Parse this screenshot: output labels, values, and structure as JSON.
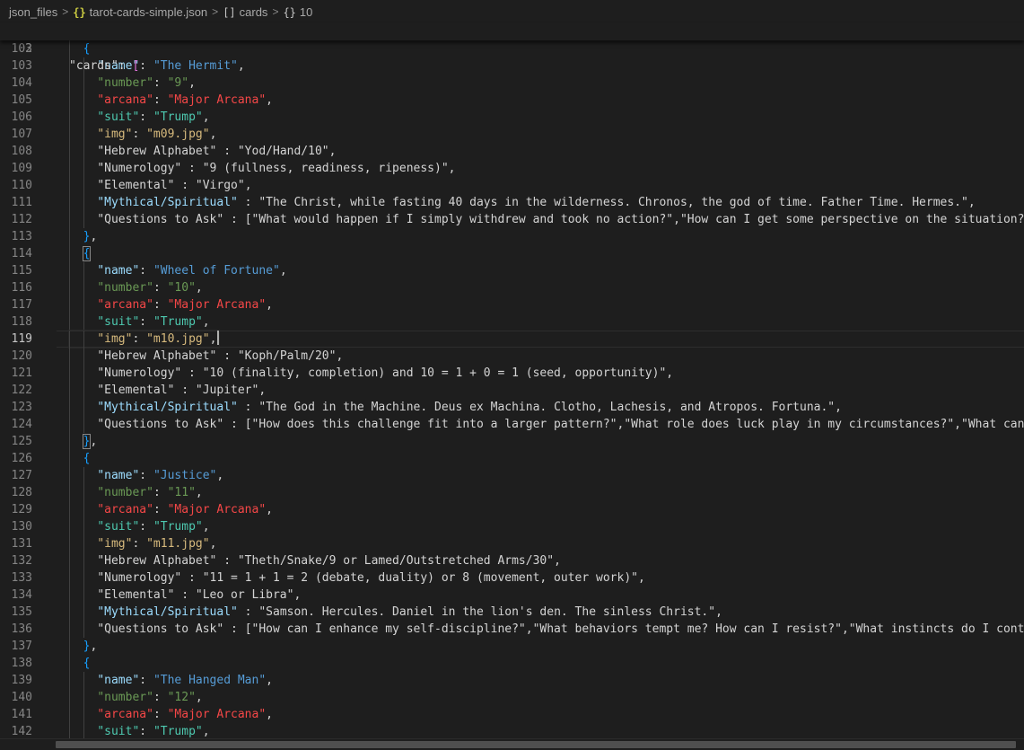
{
  "breadcrumb": {
    "folder": "json_files",
    "file": "tarot-cards-simple.json",
    "array_node": "cards",
    "object_node": "10",
    "file_icon_glyph": "{}",
    "array_icon_glyph": "[]",
    "object_icon_glyph": "{}"
  },
  "sticky_line": {
    "number": "3",
    "key": "\"cards\"",
    "sep": ": ",
    "bracket": "["
  },
  "current_line": "119",
  "lines": [
    {
      "n": "102",
      "indent": "      ",
      "tokens": [
        {
          "t": "{",
          "c": "b-brace"
        }
      ]
    },
    {
      "n": "103",
      "indent": "        ",
      "tokens": [
        {
          "t": "\"name\"",
          "c": "kn"
        },
        {
          "t": ": ",
          "c": "punc"
        },
        {
          "t": "\"The Hermit\"",
          "c": "sn"
        },
        {
          "t": ",",
          "c": "punc"
        }
      ]
    },
    {
      "n": "104",
      "indent": "        ",
      "tokens": [
        {
          "t": "\"number\"",
          "c": "kb"
        },
        {
          "t": ": ",
          "c": "punc"
        },
        {
          "t": "\"9\"",
          "c": "sb"
        },
        {
          "t": ",",
          "c": "punc"
        }
      ]
    },
    {
      "n": "105",
      "indent": "        ",
      "tokens": [
        {
          "t": "\"arcana\"",
          "c": "kr"
        },
        {
          "t": ": ",
          "c": "punc"
        },
        {
          "t": "\"Major Arcana\"",
          "c": "sr"
        },
        {
          "t": ",",
          "c": "punc"
        }
      ]
    },
    {
      "n": "106",
      "indent": "        ",
      "tokens": [
        {
          "t": "\"suit\"",
          "c": "kg"
        },
        {
          "t": ": ",
          "c": "punc"
        },
        {
          "t": "\"Trump\"",
          "c": "sg"
        },
        {
          "t": ",",
          "c": "punc"
        }
      ]
    },
    {
      "n": "107",
      "indent": "        ",
      "tokens": [
        {
          "t": "\"img\"",
          "c": "ko"
        },
        {
          "t": ": ",
          "c": "punc"
        },
        {
          "t": "\"m09.jpg\"",
          "c": "so"
        },
        {
          "t": ",",
          "c": "punc"
        }
      ]
    },
    {
      "n": "108",
      "indent": "        ",
      "tokens": [
        {
          "t": "\"Hebrew Alphabet\"",
          "c": "kw"
        },
        {
          "t": " : ",
          "c": "punc"
        },
        {
          "t": "\"Yod/Hand/10\"",
          "c": "sw"
        },
        {
          "t": ",",
          "c": "punc"
        }
      ]
    },
    {
      "n": "109",
      "indent": "        ",
      "tokens": [
        {
          "t": "\"Numerology\"",
          "c": "kw"
        },
        {
          "t": " : ",
          "c": "punc"
        },
        {
          "t": "\"9 (fullness, readiness, ripeness)\"",
          "c": "sw"
        },
        {
          "t": ",",
          "c": "punc"
        }
      ]
    },
    {
      "n": "110",
      "indent": "        ",
      "tokens": [
        {
          "t": "\"Elemental\"",
          "c": "kw"
        },
        {
          "t": " : ",
          "c": "punc"
        },
        {
          "t": "\"Virgo\"",
          "c": "sw"
        },
        {
          "t": ",",
          "c": "punc"
        }
      ]
    },
    {
      "n": "111",
      "indent": "        ",
      "tokens": [
        {
          "t": "\"Mythical/Spiritual\"",
          "c": "km"
        },
        {
          "t": " : ",
          "c": "punc"
        },
        {
          "t": "\"The Christ, while fasting 40 days in the wilderness. Chronos, the god of time. Father Time. Hermes.\"",
          "c": "sm"
        },
        {
          "t": ",",
          "c": "punc"
        }
      ]
    },
    {
      "n": "112",
      "indent": "        ",
      "tokens": [
        {
          "t": "\"Questions to Ask\"",
          "c": "kw"
        },
        {
          "t": " : ",
          "c": "punc"
        },
        {
          "t": "[",
          "c": "sw"
        },
        {
          "t": "\"What would happen if I simply withdrew and took no action?\",\"How can I get some perspective on the situation?\",",
          "c": "sw"
        }
      ]
    },
    {
      "n": "113",
      "indent": "      ",
      "tokens": [
        {
          "t": "}",
          "c": "b-brace"
        },
        {
          "t": ",",
          "c": "punc"
        }
      ]
    },
    {
      "n": "114",
      "indent": "      ",
      "tokens": [
        {
          "t": "{",
          "c": "b-brace match"
        }
      ]
    },
    {
      "n": "115",
      "indent": "        ",
      "tokens": [
        {
          "t": "\"name\"",
          "c": "kn"
        },
        {
          "t": ": ",
          "c": "punc"
        },
        {
          "t": "\"Wheel of Fortune\"",
          "c": "sn"
        },
        {
          "t": ",",
          "c": "punc"
        }
      ]
    },
    {
      "n": "116",
      "indent": "        ",
      "tokens": [
        {
          "t": "\"number\"",
          "c": "kb"
        },
        {
          "t": ": ",
          "c": "punc"
        },
        {
          "t": "\"10\"",
          "c": "sb"
        },
        {
          "t": ",",
          "c": "punc"
        }
      ]
    },
    {
      "n": "117",
      "indent": "        ",
      "tokens": [
        {
          "t": "\"arcana\"",
          "c": "kr"
        },
        {
          "t": ": ",
          "c": "punc"
        },
        {
          "t": "\"Major Arcana\"",
          "c": "sr"
        },
        {
          "t": ",",
          "c": "punc"
        }
      ]
    },
    {
      "n": "118",
      "indent": "        ",
      "tokens": [
        {
          "t": "\"suit\"",
          "c": "kg"
        },
        {
          "t": ": ",
          "c": "punc"
        },
        {
          "t": "\"Trump\"",
          "c": "sg"
        },
        {
          "t": ",",
          "c": "punc"
        }
      ]
    },
    {
      "n": "119",
      "indent": "        ",
      "tokens": [
        {
          "t": "\"img\"",
          "c": "ko"
        },
        {
          "t": ": ",
          "c": "punc"
        },
        {
          "t": "\"m10.jpg\"",
          "c": "so"
        },
        {
          "t": ",",
          "c": "punc"
        }
      ],
      "caret": true
    },
    {
      "n": "120",
      "indent": "        ",
      "tokens": [
        {
          "t": "\"Hebrew Alphabet\"",
          "c": "kw"
        },
        {
          "t": " : ",
          "c": "punc"
        },
        {
          "t": "\"Koph/Palm/20\"",
          "c": "sw"
        },
        {
          "t": ",",
          "c": "punc"
        }
      ]
    },
    {
      "n": "121",
      "indent": "        ",
      "tokens": [
        {
          "t": "\"Numerology\"",
          "c": "kw"
        },
        {
          "t": " : ",
          "c": "punc"
        },
        {
          "t": "\"10 (finality, completion) and 10 = 1 + 0 = 1 (seed, opportunity)\"",
          "c": "sw"
        },
        {
          "t": ",",
          "c": "punc"
        }
      ]
    },
    {
      "n": "122",
      "indent": "        ",
      "tokens": [
        {
          "t": "\"Elemental\"",
          "c": "kw"
        },
        {
          "t": " : ",
          "c": "punc"
        },
        {
          "t": "\"Jupiter\"",
          "c": "sw"
        },
        {
          "t": ",",
          "c": "punc"
        }
      ]
    },
    {
      "n": "123",
      "indent": "        ",
      "tokens": [
        {
          "t": "\"Mythical/Spiritual\"",
          "c": "km"
        },
        {
          "t": " : ",
          "c": "punc"
        },
        {
          "t": "\"The God in the Machine. Deus ex Machina. Clotho, Lachesis, and Atropos. Fortuna.\"",
          "c": "sm"
        },
        {
          "t": ",",
          "c": "punc"
        }
      ]
    },
    {
      "n": "124",
      "indent": "        ",
      "tokens": [
        {
          "t": "\"Questions to Ask\"",
          "c": "kw"
        },
        {
          "t": " : ",
          "c": "punc"
        },
        {
          "t": "[",
          "c": "sw"
        },
        {
          "t": "\"How does this challenge fit into a larger pattern?\",\"What role does luck play in my circumstances?\",\"What can I",
          "c": "sw"
        }
      ]
    },
    {
      "n": "125",
      "indent": "      ",
      "tokens": [
        {
          "t": "}",
          "c": "b-brace match"
        },
        {
          "t": ",",
          "c": "punc"
        }
      ]
    },
    {
      "n": "126",
      "indent": "      ",
      "tokens": [
        {
          "t": "{",
          "c": "b-brace"
        }
      ]
    },
    {
      "n": "127",
      "indent": "        ",
      "tokens": [
        {
          "t": "\"name\"",
          "c": "kn"
        },
        {
          "t": ": ",
          "c": "punc"
        },
        {
          "t": "\"Justice\"",
          "c": "sn"
        },
        {
          "t": ",",
          "c": "punc"
        }
      ]
    },
    {
      "n": "128",
      "indent": "        ",
      "tokens": [
        {
          "t": "\"number\"",
          "c": "kb"
        },
        {
          "t": ": ",
          "c": "punc"
        },
        {
          "t": "\"11\"",
          "c": "sb"
        },
        {
          "t": ",",
          "c": "punc"
        }
      ]
    },
    {
      "n": "129",
      "indent": "        ",
      "tokens": [
        {
          "t": "\"arcana\"",
          "c": "kr"
        },
        {
          "t": ": ",
          "c": "punc"
        },
        {
          "t": "\"Major Arcana\"",
          "c": "sr"
        },
        {
          "t": ",",
          "c": "punc"
        }
      ]
    },
    {
      "n": "130",
      "indent": "        ",
      "tokens": [
        {
          "t": "\"suit\"",
          "c": "kg"
        },
        {
          "t": ": ",
          "c": "punc"
        },
        {
          "t": "\"Trump\"",
          "c": "sg"
        },
        {
          "t": ",",
          "c": "punc"
        }
      ]
    },
    {
      "n": "131",
      "indent": "        ",
      "tokens": [
        {
          "t": "\"img\"",
          "c": "ko"
        },
        {
          "t": ": ",
          "c": "punc"
        },
        {
          "t": "\"m11.jpg\"",
          "c": "so"
        },
        {
          "t": ",",
          "c": "punc"
        }
      ]
    },
    {
      "n": "132",
      "indent": "        ",
      "tokens": [
        {
          "t": "\"Hebrew Alphabet\"",
          "c": "kw"
        },
        {
          "t": " : ",
          "c": "punc"
        },
        {
          "t": "\"Theth/Snake/9 or Lamed/Outstretched Arms/30\"",
          "c": "sw"
        },
        {
          "t": ",",
          "c": "punc"
        }
      ]
    },
    {
      "n": "133",
      "indent": "        ",
      "tokens": [
        {
          "t": "\"Numerology\"",
          "c": "kw"
        },
        {
          "t": " : ",
          "c": "punc"
        },
        {
          "t": "\"11 = 1 + 1 = 2 (debate, duality) or 8 (movement, outer work)\"",
          "c": "sw"
        },
        {
          "t": ",",
          "c": "punc"
        }
      ]
    },
    {
      "n": "134",
      "indent": "        ",
      "tokens": [
        {
          "t": "\"Elemental\"",
          "c": "kw"
        },
        {
          "t": " : ",
          "c": "punc"
        },
        {
          "t": "\"Leo or Libra\"",
          "c": "sw"
        },
        {
          "t": ",",
          "c": "punc"
        }
      ]
    },
    {
      "n": "135",
      "indent": "        ",
      "tokens": [
        {
          "t": "\"Mythical/Spiritual\"",
          "c": "km"
        },
        {
          "t": " : ",
          "c": "punc"
        },
        {
          "t": "\"Samson. Hercules. Daniel in the lion's den. The sinless Christ.\"",
          "c": "sm"
        },
        {
          "t": ",",
          "c": "punc"
        }
      ]
    },
    {
      "n": "136",
      "indent": "        ",
      "tokens": [
        {
          "t": "\"Questions to Ask\"",
          "c": "kw"
        },
        {
          "t": " : ",
          "c": "punc"
        },
        {
          "t": "[",
          "c": "sw"
        },
        {
          "t": "\"How can I enhance my self-discipline?\",\"What behaviors tempt me? How can I resist?\",\"What instincts do I contin",
          "c": "sw"
        }
      ]
    },
    {
      "n": "137",
      "indent": "      ",
      "tokens": [
        {
          "t": "}",
          "c": "b-brace"
        },
        {
          "t": ",",
          "c": "punc"
        }
      ]
    },
    {
      "n": "138",
      "indent": "      ",
      "tokens": [
        {
          "t": "{",
          "c": "b-brace"
        }
      ]
    },
    {
      "n": "139",
      "indent": "        ",
      "tokens": [
        {
          "t": "\"name\"",
          "c": "kn"
        },
        {
          "t": ": ",
          "c": "punc"
        },
        {
          "t": "\"The Hanged Man\"",
          "c": "sn"
        },
        {
          "t": ",",
          "c": "punc"
        }
      ]
    },
    {
      "n": "140",
      "indent": "        ",
      "tokens": [
        {
          "t": "\"number\"",
          "c": "kb"
        },
        {
          "t": ": ",
          "c": "punc"
        },
        {
          "t": "\"12\"",
          "c": "sb"
        },
        {
          "t": ",",
          "c": "punc"
        }
      ]
    },
    {
      "n": "141",
      "indent": "        ",
      "tokens": [
        {
          "t": "\"arcana\"",
          "c": "kr"
        },
        {
          "t": ": ",
          "c": "punc"
        },
        {
          "t": "\"Major Arcana\"",
          "c": "sr"
        },
        {
          "t": ",",
          "c": "punc"
        }
      ]
    },
    {
      "n": "142",
      "indent": "        ",
      "tokens": [
        {
          "t": "\"suit\"",
          "c": "kg"
        },
        {
          "t": ": ",
          "c": "punc"
        },
        {
          "t": "\"Trump\"",
          "c": "sg"
        },
        {
          "t": ",",
          "c": "punc"
        }
      ]
    }
  ]
}
